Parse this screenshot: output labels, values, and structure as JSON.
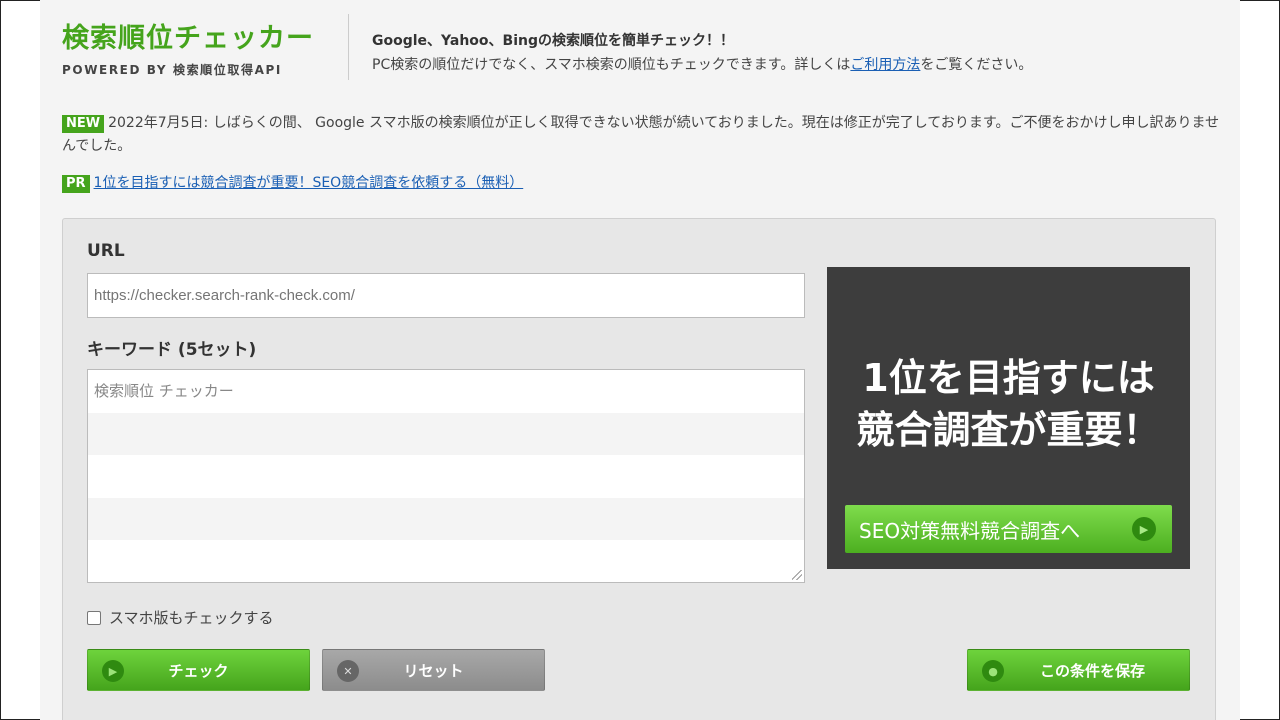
{
  "header": {
    "title": "検索順位チェッカー",
    "subtitle": "POWERED BY 検索順位取得API",
    "tagline": "Google、Yahoo、Bingの検索順位を簡単チェック！！",
    "description_before": "PC検索の順位だけでなく、スマホ検索の順位もチェックできます。詳しくは",
    "description_link": "ご利用方法",
    "description_after": "をご覧ください。"
  },
  "notice": {
    "badge": "NEW",
    "text": "2022年7月5日: しばらくの間、 Google スマホ版の検索順位が正しく取得できない状態が続いておりました。現在は修正が完了しております。ご不便をおかけし申し訳ありませんでした。"
  },
  "pr": {
    "badge": "PR",
    "link": "1位を目指すには競合調査が重要！SEO競合調査を依頼する（無料）"
  },
  "form": {
    "url_label": "URL",
    "url_placeholder": "https://checker.search-rank-check.com/",
    "keyword_label": "キーワード (5セット)",
    "keyword_placeholder": "検索順位 チェッカー",
    "mobile_label": "スマホ版もチェックする",
    "check_button": "チェック",
    "reset_button": "リセット",
    "save_button": "この条件を保存"
  },
  "banner": {
    "line1": "1位を目指すには",
    "line2": "競合調査が重要！",
    "button": "SEO対策無料競合調査へ"
  },
  "colors": {
    "brand_green": "#45a41c",
    "link_blue": "#1a5fb4",
    "banner_bg": "#3d3d3d"
  }
}
